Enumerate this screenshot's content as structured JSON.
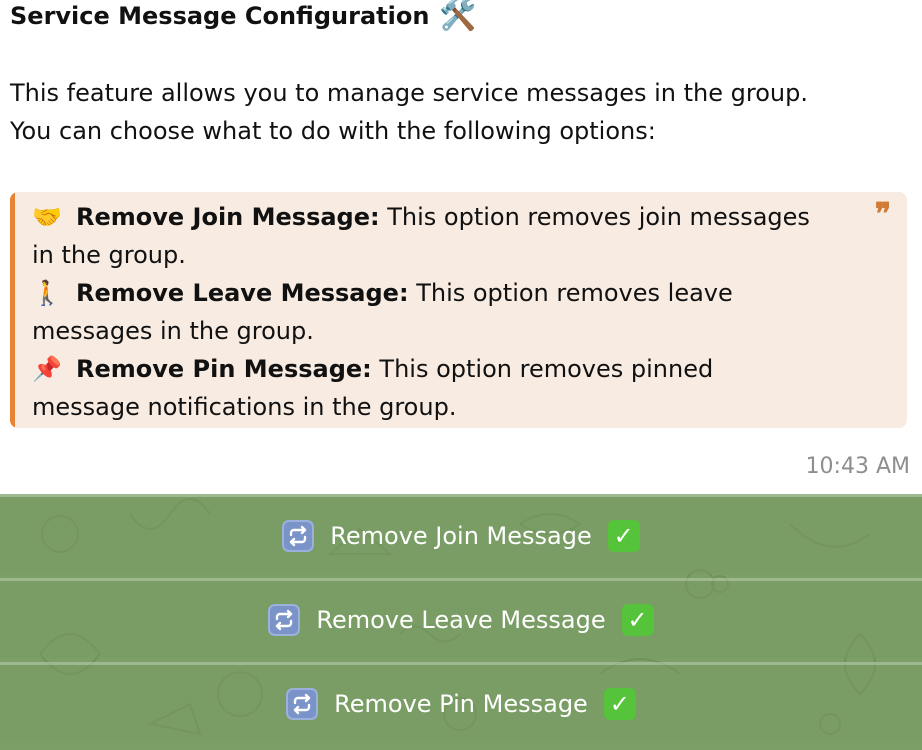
{
  "message": {
    "title": "Service Message Configuration",
    "title_icon": "🛠️",
    "intro_line1": "This feature allows you to manage service messages in the group.",
    "intro_line2": "You can choose what to do with the following options:",
    "quote_mark": "❞",
    "options": [
      {
        "icon": "🤝",
        "title": "Remove Join Message:",
        "text1": " This option removes join messages",
        "text2": "in the group."
      },
      {
        "icon": "🚶",
        "title": "Remove Leave Message:",
        "text1": " This option removes leave",
        "text2": "messages in the group."
      },
      {
        "icon": "📌",
        "title": "Remove Pin Message:",
        "text1": " This option removes pinned",
        "text2": "message notifications in the group."
      }
    ],
    "time": "10:43 AM"
  },
  "keyboard": {
    "buttons": [
      {
        "label": "Remove Join Message",
        "toggle_icon": "repeat-icon",
        "status_icon": "check-mark-icon"
      },
      {
        "label": "Remove Leave Message",
        "toggle_icon": "repeat-icon",
        "status_icon": "check-mark-icon"
      },
      {
        "label": "Remove Pin Message",
        "toggle_icon": "repeat-icon",
        "status_icon": "check-mark-icon"
      }
    ]
  },
  "colors": {
    "quote_background": "#f7ebe2",
    "quote_accent": "#e98434",
    "keyboard_background": "#7b9f66",
    "timestamp": "#8e8e8e"
  }
}
